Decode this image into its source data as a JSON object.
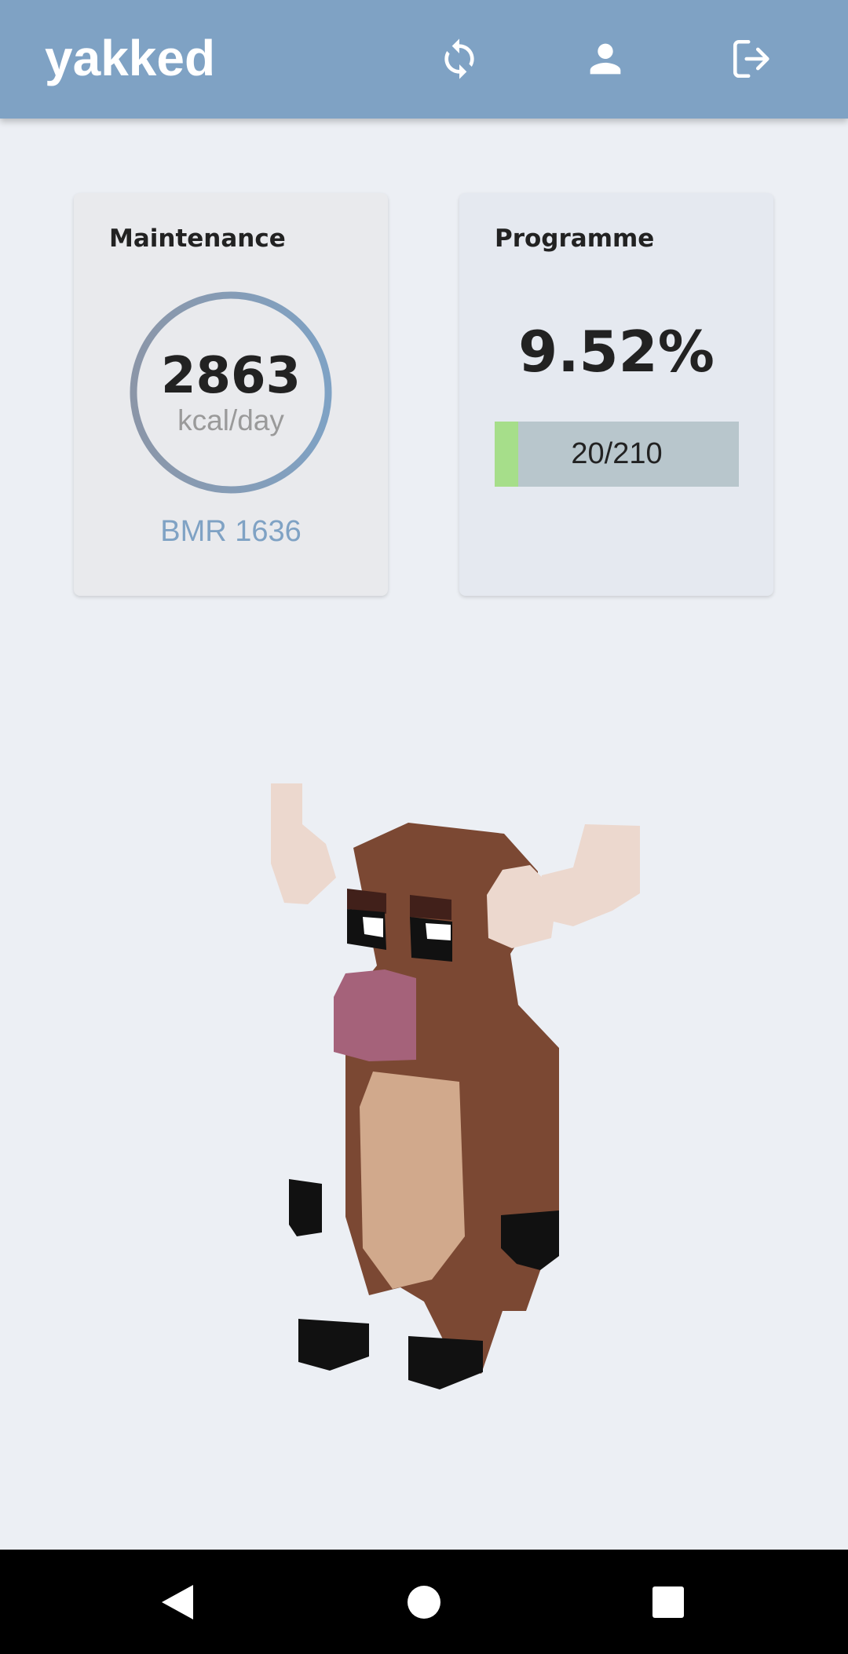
{
  "app": {
    "title": "yakked",
    "colors": {
      "appbar": "#7fa2c4",
      "background": "#eceff4",
      "accent": "#7fa2c4",
      "progress_fill": "#a6de8a"
    }
  },
  "appbar": {
    "icons": [
      "refresh-icon",
      "account-icon",
      "logout-icon"
    ]
  },
  "maintenance": {
    "title": "Maintenance",
    "kcal": "2863",
    "unit": "kcal/day",
    "bmr": "BMR 1636"
  },
  "programme": {
    "title": "Programme",
    "percent": "9.52%",
    "progress_label": "20/210",
    "progress_fraction": 0.0952
  },
  "mascot": {
    "icon": "yak-mascot"
  },
  "navbar": {
    "icons": [
      "back-icon",
      "home-icon",
      "recents-icon"
    ]
  }
}
